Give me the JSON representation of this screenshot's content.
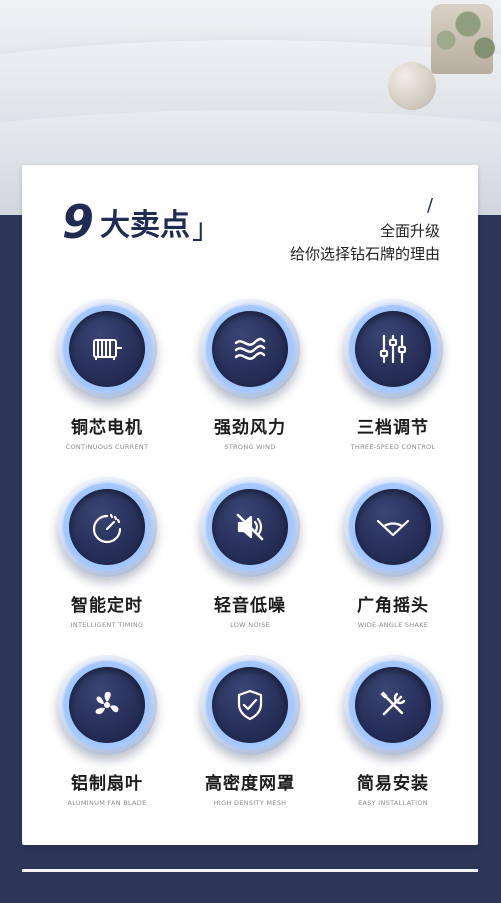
{
  "header": {
    "title_number": "9",
    "title_text": "大卖点",
    "title_bracket": "」",
    "slash": "/",
    "subtitle_line1": "全面升级",
    "subtitle_line2": "给你选择钻石牌的理由"
  },
  "features": [
    {
      "cn": "铜芯电机",
      "en": "CONTINUOUS CURRENT",
      "icon": "motor-icon"
    },
    {
      "cn": "强劲风力",
      "en": "STRONG WIND",
      "icon": "wind-icon"
    },
    {
      "cn": "三档调节",
      "en": "THREE-SPEED CONTROL",
      "icon": "sliders-icon"
    },
    {
      "cn": "智能定时",
      "en": "INTELLIGENT TIMING",
      "icon": "timer-icon"
    },
    {
      "cn": "轻音低噪",
      "en": "LOW NOISE",
      "icon": "mute-speaker-icon"
    },
    {
      "cn": "广角摇头",
      "en": "WIDE-ANGLE SHAKE",
      "icon": "wide-angle-icon"
    },
    {
      "cn": "铝制扇叶",
      "en": "ALUMINUM FAN BLADE",
      "icon": "fan-blade-icon"
    },
    {
      "cn": "高密度网罩",
      "en": "HIGH DENSITY MESH",
      "icon": "shield-check-icon"
    },
    {
      "cn": "简易安装",
      "en": "EASY INSTALLATION",
      "icon": "tools-icon"
    }
  ],
  "colors": {
    "navy": "#1f2b52",
    "background": "#2c3659",
    "card": "#ffffff",
    "icon_core": "#27305a",
    "glow": "#9ec4ff"
  }
}
